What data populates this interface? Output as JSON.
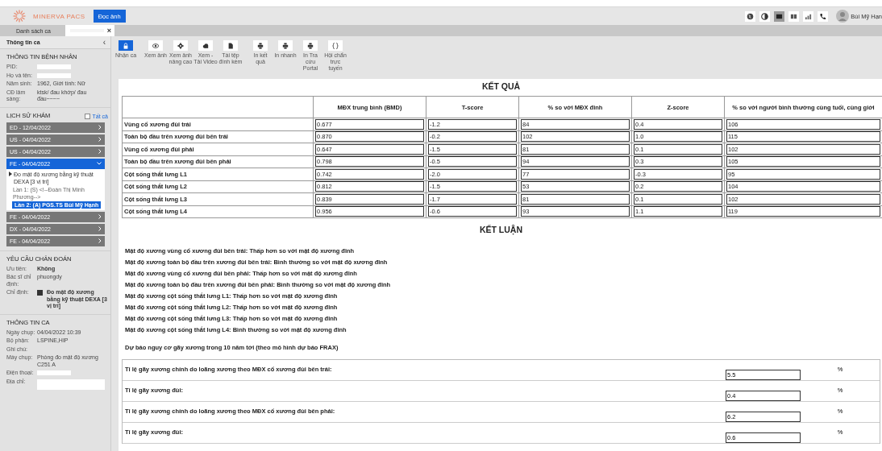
{
  "header": {
    "logo": "MINERVA PACS",
    "read_button": "Đọc ảnh",
    "tools": [
      {
        "kind": "globe",
        "selected": false
      },
      {
        "kind": "contrast",
        "selected": false
      },
      {
        "kind": "layout-single",
        "selected": true
      },
      {
        "kind": "layout-double",
        "selected": false
      },
      {
        "kind": "chart",
        "selected": false
      },
      {
        "kind": "phone",
        "selected": false
      }
    ],
    "user": "Bùi Mỹ Hạn"
  },
  "tabs": [
    {
      "label": "Danh sách ca",
      "selected": false,
      "redacted": false
    },
    {
      "label": "×",
      "selected": true,
      "redacted": true
    }
  ],
  "sidebar": {
    "title": "Thông tin ca",
    "collapse": "‹",
    "patient": {
      "heading": "THÔNG TIN BỆNH NHÂN",
      "fields": [
        {
          "label": "PID:",
          "redacted": true
        },
        {
          "label": "Họ và tên:",
          "redacted": true
        },
        {
          "label": "Năm sinh:",
          "value": "1962, Giới tính: Nữ",
          "redacted": false
        },
        {
          "label": "CĐ lâm sàng:",
          "value": "ktsk/ đau khớp/ đau đầu~~~~",
          "redacted": false
        }
      ]
    },
    "history": {
      "heading": "LỊCH SỬ KHÁM",
      "all_label": "Tất cả",
      "all_checked": false,
      "items": [
        {
          "label": "ED - 12/04/2022",
          "selected": false,
          "expanded": false
        },
        {
          "label": "US - 04/04/2022",
          "selected": false,
          "expanded": false
        },
        {
          "label": "US - 04/04/2022",
          "selected": false,
          "expanded": false
        },
        {
          "label": "FE - 04/04/2022",
          "selected": true,
          "expanded": true,
          "children": [
            {
              "label": "Đo mật độ xương bằng kỹ thuật DEXA [3 vị trí]",
              "children": [
                {
                  "label": "Lần 1: (S) <!--Đoàn Thị Minh Phương-->",
                  "selected": false
                },
                {
                  "label": "Lần 2: (A) PGS.TS Bùi Mỹ Hạnh",
                  "selected": true
                }
              ]
            }
          ]
        },
        {
          "label": "FE - 04/04/2022",
          "selected": false,
          "expanded": false
        },
        {
          "label": "DX - 04/04/2022",
          "selected": false,
          "expanded": false
        },
        {
          "label": "FE - 04/04/2022",
          "selected": false,
          "expanded": false
        }
      ]
    },
    "request": {
      "heading": "YÊU CẦU CHẨN ĐOÁN",
      "fields": [
        {
          "label": "Ưu tiên:",
          "value": "Không",
          "bold": true
        },
        {
          "label": "Bác sĩ chỉ định:",
          "value": "phuongdy",
          "bold": false
        }
      ],
      "order": {
        "label": "Chỉ định:",
        "value": "Đo mật độ xương bằng kỹ thuật DEXA [3 vị trí]",
        "checked": true
      }
    },
    "case": {
      "heading": "THÔNG TIN CA",
      "fields": [
        {
          "label": "Ngày chụp:",
          "value": "04/04/2022 10:39",
          "redacted": false
        },
        {
          "label": "Bộ phận:",
          "value": "LSPINE,HIP",
          "redacted": false
        },
        {
          "label": "Ghi chú:",
          "redacted": false
        },
        {
          "label": "Máy chụp:",
          "value": "Phòng đo mật độ xương C251 A",
          "redacted": false
        },
        {
          "label": "Điện thoại:",
          "redacted": true
        },
        {
          "label": "Địa chỉ:",
          "redacted": true
        }
      ]
    }
  },
  "toolbar": [
    {
      "label": "Nhận ca",
      "kind": "lock",
      "selected": true
    },
    {
      "label": "Xem ảnh",
      "kind": "eye",
      "selected": false
    },
    {
      "label": "Xem ảnh nâng cao",
      "kind": "gear",
      "selected": false
    },
    {
      "label": "Xem - Tải Video",
      "kind": "cloud",
      "selected": false
    },
    {
      "label": "Tài tệp đính kèm",
      "kind": "file",
      "selected": false
    },
    {
      "label": "In kết quả",
      "kind": "printer",
      "selected": false
    },
    {
      "label": "In nhanh",
      "kind": "printer",
      "selected": false
    },
    {
      "label": "In Tra cứu Portal",
      "kind": "printer",
      "selected": false
    },
    {
      "label": "Hội chẩn trực tuyến",
      "kind": "braces",
      "selected": false
    }
  ],
  "results": {
    "title": "KẾT QUẢ",
    "columns": [
      "MĐX trung bình (BMD)",
      "T-score",
      "% so với MĐX đỉnh",
      "Z-score",
      "% so với người bình thường cùng tuổi, cùng giới"
    ],
    "rows": [
      {
        "region": "Vùng cổ xương đùi trái",
        "values": [
          "0.677",
          "-1.2",
          "84",
          "0.4",
          "106"
        ]
      },
      {
        "region": "Toàn bộ đầu trên xương đùi bên trái",
        "values": [
          "0.870",
          "-0.2",
          "102",
          "1.0",
          "115"
        ]
      },
      {
        "region": "Vùng cổ xương đùi phải",
        "values": [
          "0.647",
          "-1.5",
          "81",
          "0.1",
          "102"
        ]
      },
      {
        "region": "Toàn bộ đầu trên xương đùi bên phải",
        "values": [
          "0.798",
          "-0.5",
          "94",
          "0.3",
          "105"
        ]
      },
      {
        "region": "Cột sống thắt lưng L1",
        "values": [
          "0.742",
          "-2.0",
          "77",
          "-0.3",
          "95"
        ]
      },
      {
        "region": "Cột sống thắt lưng L2",
        "values": [
          "0.812",
          "-1.5",
          "53",
          "0.2",
          "104"
        ]
      },
      {
        "region": "Cột sống thắt lưng L3",
        "values": [
          "0.839",
          "-1.7",
          "81",
          "0.1",
          "102"
        ]
      },
      {
        "region": "Cột sống thắt lưng L4",
        "values": [
          "0.956",
          "-0.6",
          "93",
          "1.1",
          "119"
        ]
      }
    ]
  },
  "conclusion": {
    "title": "KẾT LUẬN",
    "lines": [
      "Mật độ xương vùng cổ xương đùi bên trái: Thấp hơn so với mật độ xương đỉnh",
      "Mật độ xương toàn bộ đầu trên xương đùi bên trái: Bình thường so với mật độ xương đỉnh",
      "Mật độ xương vùng cổ xương đùi bên phải: Thấp hơn so với mật độ xương đỉnh",
      "Mật độ xương toàn bộ đầu trên xương đùi bên phải: Bình thường so với mật độ xương đỉnh",
      "Mật độ xương cột sống thắt lưng L1: Thấp hơn so với mật độ xương đỉnh",
      "Mật độ xương cột sống thắt lưng L2: Thấp hơn so với mật độ xương đỉnh",
      "Mật độ xương cột sống thắt lưng L3: Thấp hơn so với mật độ xương đỉnh",
      "Mật độ xương cột sống thắt lưng L4: Bình thường so với mật độ xương đỉnh"
    ]
  },
  "frax": {
    "title": "Dự báo nguy cơ gãy xương trong 10 năm tới (theo mô hình dự báo FRAX)",
    "rows": [
      {
        "label": "Tỉ lệ gãy xương chính do loãng xương theo MĐX cổ xương đùi bên trái:",
        "value": "5.5",
        "unit": "%"
      },
      {
        "label": "Tỉ lệ gãy xương đùi:",
        "value": "0.4",
        "unit": "%"
      },
      {
        "label": "Tỉ lệ gãy xương chính do loãng xương theo MĐX cổ xương đùi bên phải:",
        "value": "6.2",
        "unit": "%"
      },
      {
        "label": "Tỉ lệ gãy xương đùi:",
        "value": "0.6",
        "unit": "%"
      }
    ]
  }
}
